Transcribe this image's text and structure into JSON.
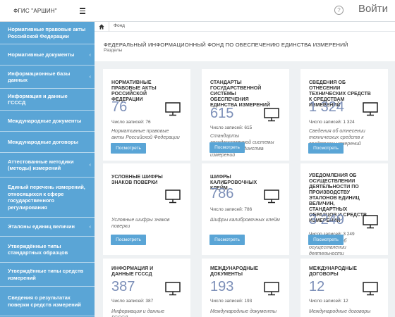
{
  "app": {
    "title": "ФГИС \"АРШИН\"",
    "login_label": "Войти",
    "help_label": "?"
  },
  "sidebar": {
    "items": [
      {
        "label": "Нормативные правовые акты Российской Федерации",
        "has_children": false
      },
      {
        "label": "Нормативные документы",
        "has_children": true
      },
      {
        "label": "Информационные базы данных",
        "has_children": true
      },
      {
        "label": "Информация и данные ГСССД",
        "has_children": false
      },
      {
        "label": "Международные документы",
        "has_children": false
      },
      {
        "label": "Международные договоры",
        "has_children": false
      },
      {
        "label": "Аттестованные методики (методы) измерений",
        "has_children": true
      },
      {
        "label": "Единый перечень измерений, относящихся к сфере государственного регулирования",
        "has_children": false
      },
      {
        "label": "Эталоны единиц величин",
        "has_children": true
      },
      {
        "label": "Утверждённые типы стандартных образцов",
        "has_children": false
      },
      {
        "label": "Утверждённые типы средств измерений",
        "has_children": false
      },
      {
        "label": "Сведения о результатах поверки средств измерений",
        "has_children": false
      }
    ]
  },
  "breadcrumb": {
    "items": [
      "Фонд"
    ]
  },
  "page": {
    "title": "ФЕДЕРАЛЬНЫЙ ИНФОРМАЦИОННЫЙ ФОНД ПО ОБЕСПЕЧЕНИЮ ЕДИНСТВА ИЗМЕРЕНИЙ",
    "subtitle": "Разделы"
  },
  "cards": [
    {
      "title": "Нормативные правовые акты Российской Федерации",
      "count": "76",
      "count_label": "Число записей: 76",
      "description": "Нормативные правовые акты Российской Федерации",
      "button": "Посмотреть"
    },
    {
      "title": "Стандарты государственной системы обеспечения единства измерений",
      "count": "615",
      "count_label": "Число записей: 615",
      "description": "Стандарты государственной системы обеспечения единства измерений",
      "button": "Посмотреть"
    },
    {
      "title": "Сведения об отнесении технических средств к средствам измерений",
      "count": "1 324",
      "count_label": "Число записей: 1 324",
      "description": "Сведения об отнесении технических средств к средствам измерений",
      "button": "Посмотреть"
    },
    {
      "title": "Условные шифры знаков поверки",
      "count": "",
      "count_label": "",
      "description": "Условные шифры знаков поверки",
      "button": "Посмотреть"
    },
    {
      "title": "Шифры калибровочных клейм",
      "count": "786",
      "count_label": "Число записей: 786",
      "description": "Шифры калибровочных клейм",
      "button": "Посмотреть"
    },
    {
      "title": "Уведомления об осуществлении деятельности по производству эталонов единиц величин, стандартных образцов и средств измерений",
      "count": "3 249",
      "count_label": "Число записей: 3 249",
      "description": "Уведомления об осуществлении деятельности",
      "button": "Посмотреть"
    },
    {
      "title": "Информация и данные ГСССД",
      "count": "387",
      "count_label": "Число записей: 387",
      "description": "Информация и данные ГСССД",
      "button": "Посмотреть"
    },
    {
      "title": "Международные документы",
      "count": "193",
      "count_label": "Число записей: 193",
      "description": "Международные документы",
      "button": "Посмотреть"
    },
    {
      "title": "Международные договоры",
      "count": "12",
      "count_label": "Число записей: 12",
      "description": "Международные договоры",
      "button": "Посмотреть"
    }
  ]
}
